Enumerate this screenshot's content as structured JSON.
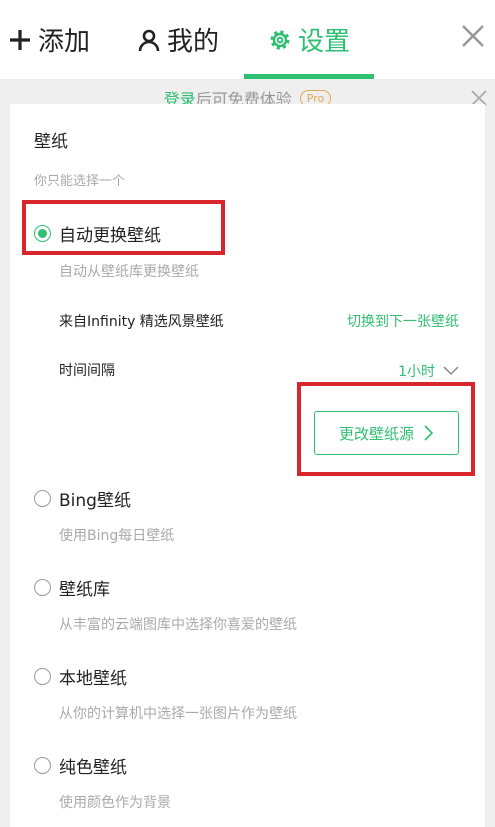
{
  "header": {
    "tabs": [
      {
        "label": "添加",
        "icon": "plus-icon"
      },
      {
        "label": "我的",
        "icon": "user-icon"
      },
      {
        "label": "设置",
        "icon": "gear-icon"
      }
    ],
    "active_tab": "设置",
    "close_icon": "close-icon"
  },
  "banner": {
    "login_text": "登录",
    "rest_text": "后可免费体验",
    "badge": "Pro"
  },
  "wallpaper": {
    "title": "壁纸",
    "subtitle": "你只能选择一个",
    "options": [
      {
        "label": "自动更换壁纸",
        "desc": "自动从壁纸库更换壁纸",
        "selected": true
      },
      {
        "label": "Bing壁纸",
        "desc": "使用Bing每日壁纸",
        "selected": false
      },
      {
        "label": "壁纸库",
        "desc": "从丰富的云端图库中选择你喜爱的壁纸",
        "selected": false
      },
      {
        "label": "本地壁纸",
        "desc": "从你的计算机中选择一张图片作为壁纸",
        "selected": false
      },
      {
        "label": "纯色壁纸",
        "desc": "使用颜色作为背景",
        "selected": false
      }
    ],
    "auto": {
      "source_label": "来自Infinity 精选风景壁纸",
      "next_link": "切换到下一张壁纸",
      "interval_label": "时间间隔",
      "interval_value": "1小时",
      "change_source_button": "更改壁纸源"
    }
  },
  "colors": {
    "accent": "#2fbf71",
    "highlight": "#d9262c",
    "pro_badge": "#e0a85a"
  }
}
